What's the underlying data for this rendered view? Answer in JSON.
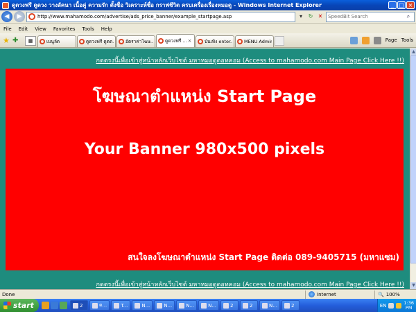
{
  "window": {
    "title": "ดูดวงฟรี ดูดวง วางลัคนา เนื้อคู่ ความรัก ตั้งชื่อ วิเคราะห์ชื่อ กราฟชีวิต ครบเครื่องเรื่องหมอดู - Windows Internet Explorer"
  },
  "address": {
    "url": "http://www.mahamodo.com/advertise/ads_price_banner/example_startpage.asp",
    "search_placeholder": "SpeedBit Search"
  },
  "menu": [
    "File",
    "Edit",
    "View",
    "Favorites",
    "Tools",
    "Help"
  ],
  "tabs": [
    {
      "label": "เมนูลัด"
    },
    {
      "label": "ดูดวงฟรี ดูดด..."
    },
    {
      "label": "อัตราค่าโฆษ..."
    },
    {
      "label": "ดูดวงฟรี ..."
    },
    {
      "label": "บันเทิง enter..."
    },
    {
      "label": "MENU Admin..."
    }
  ],
  "toolbar": {
    "page": "Page",
    "tools": "Tools"
  },
  "content": {
    "top_link": "กดตรงนี้เพื่อเข้าสู่หน้าหลักเว็บไซต์ มหาหมอดูดอทคอม (Access to mahamodo.com Main Page Click Here !!)",
    "banner_title": "โฆษณาตำแหน่ง Start Page",
    "banner_size": "Your Banner 980x500 pixels",
    "banner_contact": "สนใจลงโฆษณาตำแหน่ง Start Page ติดต่อ 089-9405715 (มหาแซม)",
    "bottom_link": "กดตรงนี้เพื่อเข้าสู่หน้าหลักเว็บไซต์ มหาหมอดูดอทคอม (Access to mahamodo.com Main Page Click Here !!)"
  },
  "status": {
    "left": "Done",
    "zone": "Internet",
    "zoom": "100%"
  },
  "taskbar": {
    "start": "start",
    "tasks": [
      "2",
      "ต...",
      "T...",
      "N...",
      "N...",
      "N...",
      "N...",
      "2",
      "2",
      "N...",
      "2"
    ],
    "lang": "EN",
    "time": "1:36",
    "ampm": "PM"
  },
  "colors": {
    "page_bg": "#1e8c7e",
    "banner_bg": "#ff0000",
    "link": "#ffffff"
  }
}
